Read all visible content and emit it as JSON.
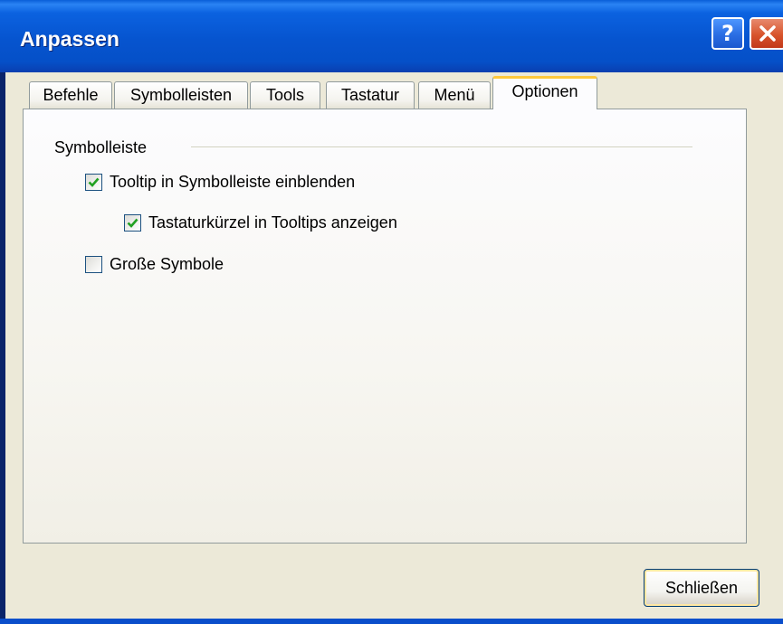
{
  "window": {
    "title": "Anpassen",
    "help_glyph": "?"
  },
  "tabs": [
    {
      "label": "Befehle",
      "active": false
    },
    {
      "label": "Symbolleisten",
      "active": false
    },
    {
      "label": "Tools",
      "active": false
    },
    {
      "label": "Tastatur",
      "active": false
    },
    {
      "label": "Menü",
      "active": false
    },
    {
      "label": "Optionen",
      "active": true
    }
  ],
  "options": {
    "group_label": "Symbolleiste",
    "checkboxes": [
      {
        "label": "Tooltip in Symbolleiste einblenden",
        "checked": true
      },
      {
        "label": "Tastaturkürzel in Tooltips anzeigen",
        "checked": true
      },
      {
        "label": "Große Symbole",
        "checked": false
      }
    ]
  },
  "footer": {
    "close_label": "Schließen"
  },
  "colors": {
    "titlebar": "#0654cf",
    "dialog_face": "#ece9d8",
    "active_tab_highlight": "#ffc83c",
    "checkmark": "#21a121"
  },
  "icons": {
    "help": "help-icon",
    "close": "close-icon",
    "checkmark": "checkmark-icon"
  }
}
